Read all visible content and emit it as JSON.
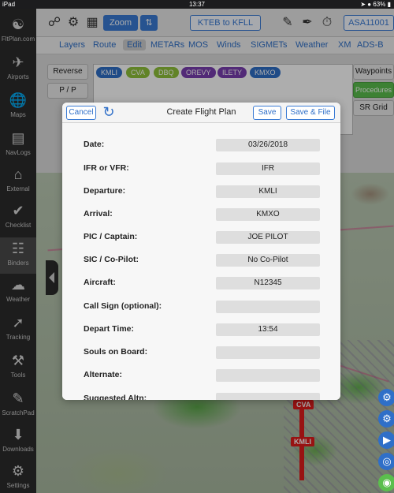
{
  "status_bar": {
    "device": "iPad",
    "time": "13:37",
    "battery": "63%"
  },
  "sidebar": {
    "items": [
      {
        "label": "FltPlan.com",
        "icon": "fltplan-logo-icon"
      },
      {
        "label": "Airports",
        "icon": "airports-icon"
      },
      {
        "label": "Maps",
        "icon": "maps-icon"
      },
      {
        "label": "NavLogs",
        "icon": "navlogs-icon"
      },
      {
        "label": "External",
        "icon": "external-icon"
      },
      {
        "label": "Checklist",
        "icon": "checklist-icon"
      },
      {
        "label": "Binders",
        "icon": "binders-icon"
      },
      {
        "label": "Weather",
        "icon": "weather-icon"
      },
      {
        "label": "Tracking",
        "icon": "tracking-icon"
      },
      {
        "label": "Tools",
        "icon": "tools-icon"
      },
      {
        "label": "ScratchPad",
        "icon": "scratchpad-icon"
      },
      {
        "label": "Downloads",
        "icon": "downloads-icon"
      },
      {
        "label": "Settings",
        "icon": "settings-icon"
      }
    ]
  },
  "toolbar": {
    "zoom_label": "Zoom",
    "route_label": "KTEB to KFLL",
    "aircraft_label": "ASA11001"
  },
  "tabs": [
    "Layers",
    "Route",
    "Edit",
    "METARs",
    "MOS",
    "Winds",
    "SIGMETs",
    "Weather",
    "XM",
    "ADS-B"
  ],
  "active_tab": "Edit",
  "edit_panel": {
    "reverse_label": "Reverse",
    "pp_label": "P / P",
    "waypoints_label": "Waypoints",
    "procedures_label": "Procedures",
    "sr_grid_label": "SR Grid",
    "chips": [
      {
        "label": "KMLI",
        "color": "#2f6fc8"
      },
      {
        "label": "CVA",
        "color": "#8fc23a"
      },
      {
        "label": "DBQ",
        "color": "#8fc23a"
      },
      {
        "label": "OREVY",
        "color": "#7a3fb0"
      },
      {
        "label": "ILETY",
        "color": "#7a3fb0"
      },
      {
        "label": "KMXO",
        "color": "#2f6fc8"
      }
    ]
  },
  "map_labels": {
    "waypoint_cva": "CVA",
    "airport_kmli": "KMLI"
  },
  "modal": {
    "title": "Create Flight Plan",
    "cancel_label": "Cancel",
    "save_label": "Save",
    "save_file_label": "Save & File",
    "fields": [
      {
        "label": "Date:",
        "value": "03/26/2018"
      },
      {
        "label": "IFR or VFR:",
        "value": "IFR"
      },
      {
        "label": "Departure:",
        "value": "KMLI"
      },
      {
        "label": "Arrival:",
        "value": "KMXO"
      },
      {
        "label": "PIC / Captain:",
        "value": "JOE PILOT"
      },
      {
        "label": "SIC / Co-Pilot:",
        "value": "No Co-Pilot"
      },
      {
        "label": "Aircraft:",
        "value": "N12345"
      },
      {
        "label": "Call Sign (optional):",
        "value": ""
      },
      {
        "label": "Depart Time:",
        "value": "13:54"
      },
      {
        "label": "Souls on Board:",
        "value": ""
      },
      {
        "label": "Alternate:",
        "value": ""
      },
      {
        "label": "Suggested Altn:",
        "value": ""
      }
    ]
  }
}
